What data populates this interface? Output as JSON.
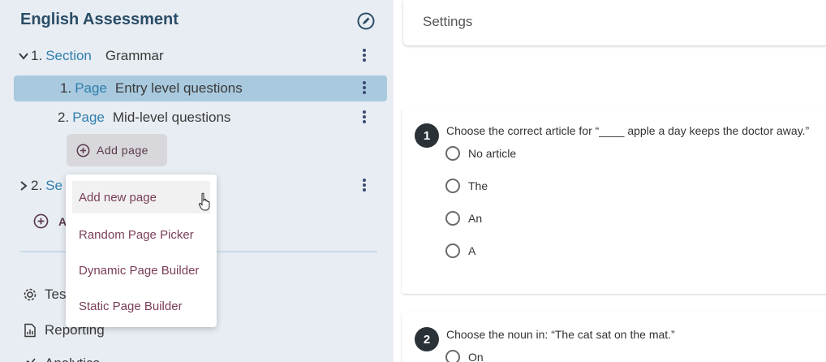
{
  "sidebar": {
    "title": "English Assessment",
    "sections": [
      {
        "number": "1.",
        "kind": "Section",
        "name": "Grammar",
        "pages": [
          {
            "number": "1.",
            "kind": "Page",
            "name": "Entry level questions"
          },
          {
            "number": "2.",
            "kind": "Page",
            "name": "Mid-level questions"
          }
        ],
        "add_page_label": "Add page"
      },
      {
        "number": "2.",
        "kind": "Se"
      }
    ],
    "add_section_partial": "A",
    "bottom": [
      {
        "label": "Tes",
        "icon": "gear-icon"
      },
      {
        "label": "Reporting",
        "icon": "report-icon"
      },
      {
        "label": "Analytics",
        "icon": "analytics-icon"
      }
    ]
  },
  "menu": {
    "items": [
      "Add new page",
      "Random Page Picker",
      "Dynamic Page Builder",
      "Static Page Builder"
    ]
  },
  "main": {
    "settings_label": "Settings",
    "questions": [
      {
        "number": "1",
        "text": "Choose the correct article for “____ apple a day keeps the doctor away.”",
        "options": [
          "No article",
          "The",
          "An",
          "A"
        ]
      },
      {
        "number": "2",
        "text": "Choose the noun in: “The cat sat on the mat.”",
        "options": [
          "On"
        ]
      }
    ]
  }
}
